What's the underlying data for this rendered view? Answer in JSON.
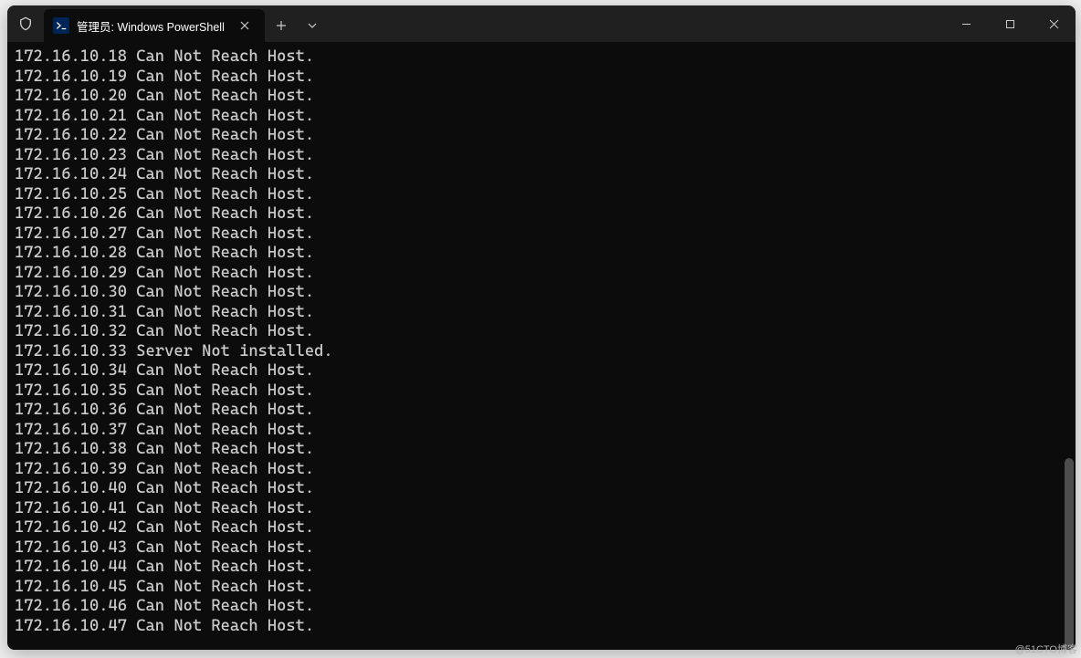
{
  "titlebar": {
    "shield_tooltip": "Shield",
    "tab": {
      "icon_label": ">_",
      "title": "管理员: Windows PowerShell",
      "close_label": "✕"
    },
    "new_tab_label": "+",
    "dropdown_label": "⌄",
    "minimize_label": "—",
    "maximize_label": "□",
    "close_label": "✕"
  },
  "terminal": {
    "lines": [
      "172.16.10.18 Can Not Reach Host.",
      "172.16.10.19 Can Not Reach Host.",
      "172.16.10.20 Can Not Reach Host.",
      "172.16.10.21 Can Not Reach Host.",
      "172.16.10.22 Can Not Reach Host.",
      "172.16.10.23 Can Not Reach Host.",
      "172.16.10.24 Can Not Reach Host.",
      "172.16.10.25 Can Not Reach Host.",
      "172.16.10.26 Can Not Reach Host.",
      "172.16.10.27 Can Not Reach Host.",
      "172.16.10.28 Can Not Reach Host.",
      "172.16.10.29 Can Not Reach Host.",
      "172.16.10.30 Can Not Reach Host.",
      "172.16.10.31 Can Not Reach Host.",
      "172.16.10.32 Can Not Reach Host.",
      "172.16.10.33 Server Not installed.",
      "172.16.10.34 Can Not Reach Host.",
      "172.16.10.35 Can Not Reach Host.",
      "172.16.10.36 Can Not Reach Host.",
      "172.16.10.37 Can Not Reach Host.",
      "172.16.10.38 Can Not Reach Host.",
      "172.16.10.39 Can Not Reach Host.",
      "172.16.10.40 Can Not Reach Host.",
      "172.16.10.41 Can Not Reach Host.",
      "172.16.10.42 Can Not Reach Host.",
      "172.16.10.43 Can Not Reach Host.",
      "172.16.10.44 Can Not Reach Host.",
      "172.16.10.45 Can Not Reach Host.",
      "172.16.10.46 Can Not Reach Host.",
      "172.16.10.47 Can Not Reach Host."
    ]
  },
  "watermark": "@51CTO博客"
}
